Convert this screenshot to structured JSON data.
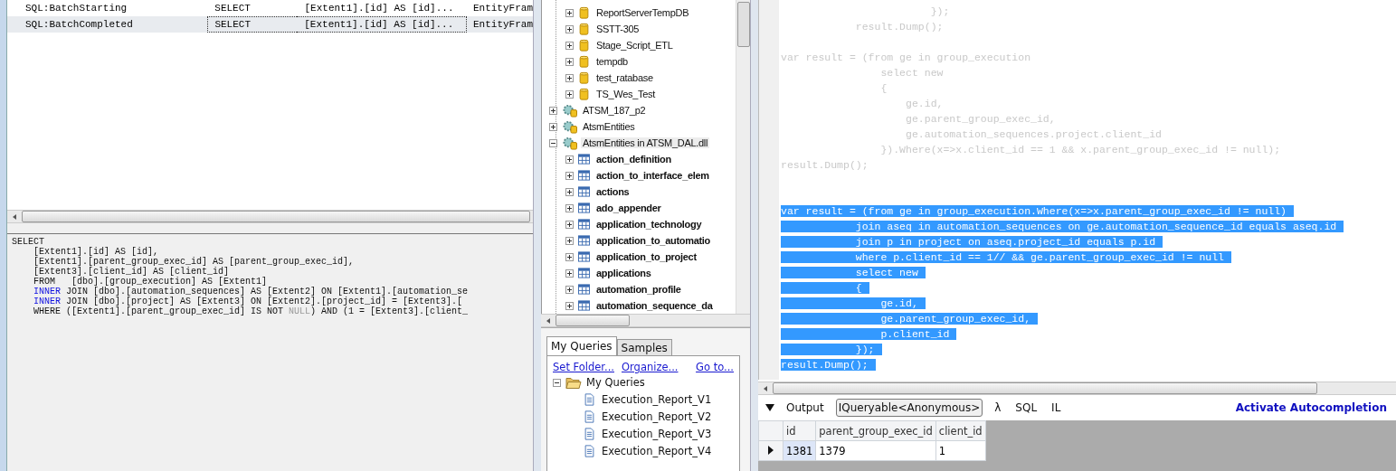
{
  "trace": {
    "rows": [
      {
        "event": "SQL:BatchStarting",
        "column_2": "SELECT",
        "column_3": "[Extent1].[id] AS [id]...",
        "column_4": "EntityFram",
        "selected": false
      },
      {
        "event": "SQL:BatchCompleted",
        "column_2": "SELECT",
        "column_3": "[Extent1].[id] AS [id]...",
        "column_4": "EntityFram",
        "selected": true
      }
    ],
    "sql_text": [
      [
        {
          "kind": "plain",
          "text": "SELECT"
        }
      ],
      [
        {
          "kind": "plain",
          "text": "    [Extent1].[id] AS [id],"
        }
      ],
      [
        {
          "kind": "plain",
          "text": "    [Extent1].[parent_group_exec_id] AS [parent_group_exec_id],"
        }
      ],
      [
        {
          "kind": "plain",
          "text": "    [Extent3].[client_id] AS [client_id]"
        }
      ],
      [
        {
          "kind": "plain",
          "text": "    FROM   [dbo].[group_execution] AS [Extent1]"
        }
      ],
      [
        {
          "kind": "keyword",
          "text": "    INNER"
        },
        {
          "kind": "plain",
          "text": " JOIN [dbo].[automation_sequences] AS [Extent2] ON [Extent1].[automation_se"
        }
      ],
      [
        {
          "kind": "keyword",
          "text": "    INNER"
        },
        {
          "kind": "plain",
          "text": " JOIN [dbo].[project] AS [Extent3] ON [Extent2].[project_id] = [Extent3].["
        }
      ],
      [
        {
          "kind": "plain",
          "text": "    WHERE ([Extent1].[parent_group_exec_id] IS NOT "
        },
        {
          "kind": "literal",
          "text": "NULL"
        },
        {
          "kind": "plain",
          "text": ") AND (1 = [Extent3].[client_"
        }
      ]
    ]
  },
  "explorer": {
    "databases": [
      {
        "label": "ReportServerTempDB",
        "expanded": false
      },
      {
        "label": "SSTT-305",
        "expanded": false
      },
      {
        "label": "Stage_Script_ETL",
        "expanded": false
      },
      {
        "label": "tempdb",
        "expanded": false
      },
      {
        "label": "test_ratabase",
        "expanded": false
      },
      {
        "label": "TS_Wes_Test",
        "expanded": false
      }
    ],
    "connections": [
      {
        "label": "ATSM_187_p2",
        "expanded": false,
        "selected": false
      },
      {
        "label": "AtsmEntities",
        "expanded": false,
        "selected": false
      },
      {
        "label": "AtsmEntities in ATSM_DAL.dll",
        "expanded": true,
        "selected": true,
        "children": [
          {
            "label": "action_definition",
            "expanded": false
          },
          {
            "label": "action_to_interface_elem",
            "expanded": false
          },
          {
            "label": "actions",
            "expanded": false
          },
          {
            "label": "ado_appender",
            "expanded": false
          },
          {
            "label": "application_technology",
            "expanded": false
          },
          {
            "label": "application_to_automatio",
            "expanded": false
          },
          {
            "label": "application_to_project",
            "expanded": false
          },
          {
            "label": "applications",
            "expanded": false
          },
          {
            "label": "automation_profile",
            "expanded": false
          },
          {
            "label": "automation_sequence_da",
            "expanded": false
          }
        ]
      }
    ]
  },
  "query_tabs": [
    {
      "label": "My Queries",
      "selected": true
    },
    {
      "label": "Samples",
      "selected": false
    }
  ],
  "query_links": [
    "Set Folder...",
    "Organize..."
  ],
  "goto_link": "Go to...",
  "queries": [
    {
      "label": "My Queries",
      "expanded": true,
      "children": [
        {
          "label": "Execution_Report_V1"
        },
        {
          "label": "Execution_Report_V2"
        },
        {
          "label": "Execution_Report_V3"
        },
        {
          "label": "Execution_Report_V4"
        }
      ]
    }
  ],
  "editor": {
    "lines": [
      {
        "kind": "code",
        "text": "                        });",
        "selected": false
      },
      {
        "kind": "code",
        "text": "            result.Dump();",
        "selected": false
      },
      {
        "kind": "blank"
      },
      {
        "kind": "code",
        "text": "var result = (from ge in group_execution",
        "selected": false
      },
      {
        "kind": "code",
        "text": "                select new",
        "selected": false
      },
      {
        "kind": "code",
        "text": "                {",
        "selected": false
      },
      {
        "kind": "code",
        "text": "                    ge.id,",
        "selected": false
      },
      {
        "kind": "code",
        "text": "                    ge.parent_group_exec_id,",
        "selected": false
      },
      {
        "kind": "code",
        "text": "                    ge.automation_sequences.project.client_id",
        "selected": false
      },
      {
        "kind": "code",
        "text": "                }).Where(x=>x.client_id == 1 && x.parent_group_exec_id != null);",
        "selected": false
      },
      {
        "kind": "code",
        "text": "result.Dump();",
        "selected": false
      },
      {
        "kind": "blank"
      },
      {
        "kind": "blank"
      },
      {
        "kind": "code",
        "text": "var result = (from ge in group_execution.Where(x=>x.parent_group_exec_id != null)",
        "selected": true
      },
      {
        "kind": "code",
        "text": "            join aseq in automation_sequences on ge.automation_sequence_id equals aseq.id",
        "selected": true
      },
      {
        "kind": "code",
        "text": "            join p in project on aseq.project_id equals p.id",
        "selected": true
      },
      {
        "kind": "code",
        "text": "            where p.client_id == 1// && ge.parent_group_exec_id != null",
        "selected": true
      },
      {
        "kind": "code",
        "text": "            select new",
        "selected": true
      },
      {
        "kind": "code",
        "text": "            {",
        "selected": true
      },
      {
        "kind": "code",
        "text": "                ge.id,",
        "selected": true
      },
      {
        "kind": "code",
        "text": "                ge.parent_group_exec_id,",
        "selected": true
      },
      {
        "kind": "code",
        "text": "                p.client_id",
        "selected": true
      },
      {
        "kind": "code",
        "text": "            });",
        "selected": true
      },
      {
        "kind": "code",
        "text": "result.Dump();",
        "selected": true
      }
    ]
  },
  "output_bar": {
    "options": [
      {
        "label": "Output",
        "selected": false
      },
      {
        "label": "IQueryable<Anonymous>",
        "selected": true
      },
      {
        "label": "λ",
        "selected": false
      },
      {
        "label": "SQL",
        "selected": false
      },
      {
        "label": "IL",
        "selected": false
      }
    ],
    "autocompletion": "Activate Autocompletion"
  },
  "results": {
    "columns": [
      "id",
      "parent_group_exec_id",
      "client_id"
    ],
    "rows": [
      {
        "cells": [
          "1381",
          "1379",
          "1"
        ],
        "selected": true
      }
    ]
  }
}
